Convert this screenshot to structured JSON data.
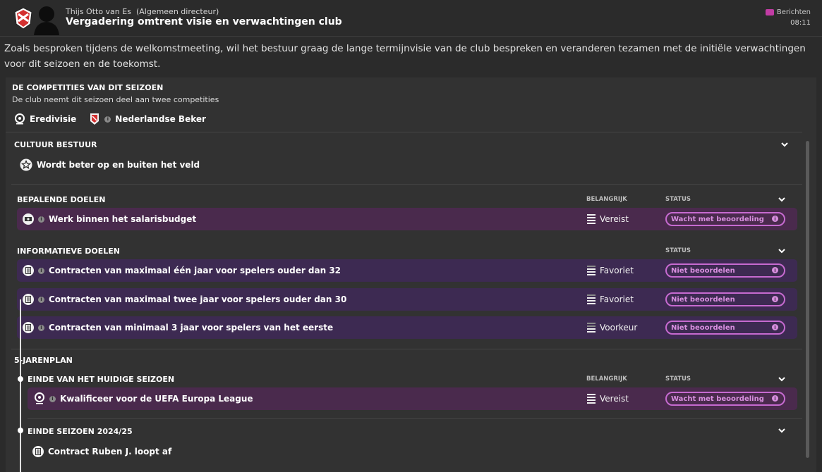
{
  "header": {
    "sender_name": "Thijs Otto van Es",
    "sender_role": "(Algemeen directeur)",
    "subject": "Vergadering omtrent visie en verwachtingen club",
    "berichten_label": "Berichten",
    "time": "08:11"
  },
  "intro_text": "Zoals besproken tijdens de welkomstmeeting, wil het bestuur graag de lange termijnvisie van de club bespreken en veranderen tezamen met de initiële verwachtingen voor dit seizoen en de toekomst.",
  "competitions": {
    "title": "DE COMPETITIES VAN DIT SEIZOEN",
    "subtitle": "De club neemt dit seizoen deel aan twee competities",
    "items": [
      "Eredivisie",
      "Nederlandse Beker"
    ]
  },
  "culture": {
    "title": "CULTUUR BESTUUR",
    "item": "Wordt beter op en buiten het veld"
  },
  "defining_goals": {
    "title": "BEPALENDE DOELEN",
    "col_importance": "BELANGRIJK",
    "col_status": "STATUS",
    "rows": [
      {
        "label": "Werk binnen het salarisbudget",
        "importance": "Vereist",
        "status": "Wacht met beoordeling"
      }
    ]
  },
  "informative_goals": {
    "title": "INFORMATIEVE DOELEN",
    "col_status": "STATUS",
    "rows": [
      {
        "label": "Contracten van maximaal één jaar voor spelers ouder dan 32",
        "importance": "Favoriet",
        "status": "Niet beoordelen"
      },
      {
        "label": "Contracten van maximaal twee jaar voor spelers ouder dan 30",
        "importance": "Favoriet",
        "status": "Niet beoordelen"
      },
      {
        "label": "Contracten van minimaal 3 jaar voor spelers van het eerste",
        "importance": "Voorkeur",
        "status": "Niet beoordelen"
      }
    ]
  },
  "five_year_plan": {
    "title": "5-JARENPLAN",
    "stage1": {
      "title": "EINDE VAN HET HUIDIGE SEIZOEN",
      "col_importance": "BELANGRIJK",
      "col_status": "STATUS",
      "row": {
        "label": "Kwalificeer voor de UEFA Europa League",
        "importance": "Vereist",
        "status": "Wacht met beoordeling"
      }
    },
    "stage2": {
      "title": "EINDE SEIZOEN 2024/25",
      "item": "Contract Ruben J. loopt af"
    }
  }
}
